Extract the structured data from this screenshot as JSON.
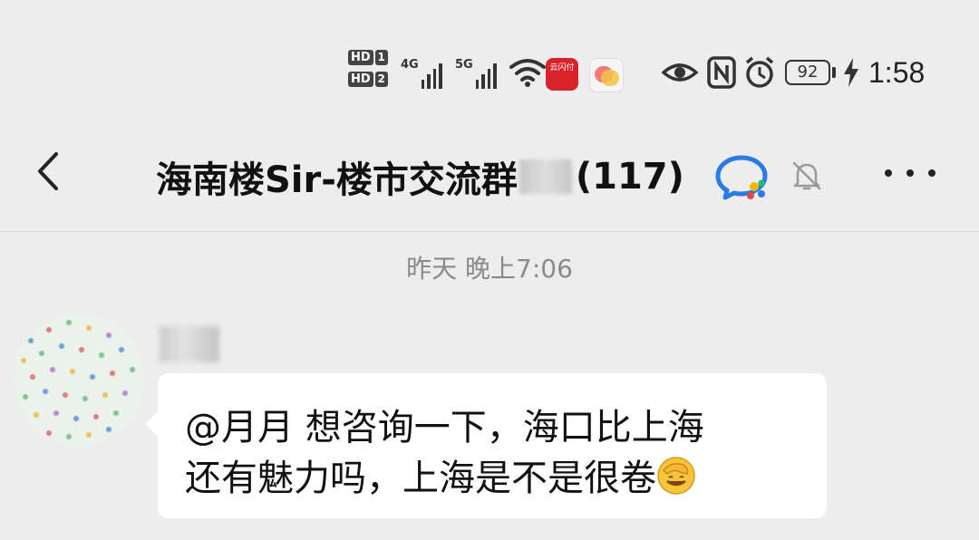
{
  "status_bar": {
    "hd_badges": [
      {
        "label": "HD",
        "sim": "1"
      },
      {
        "label": "HD",
        "sim": "2"
      }
    ],
    "signal_1": "4G",
    "signal_2": "5G",
    "app_icon_text": "云闪付",
    "battery": "92",
    "time": "1:58",
    "icons": [
      "hd-1-icon",
      "hd-2-icon",
      "signal-4g-icon",
      "signal-5g-icon",
      "wifi-icon",
      "unionpay-app-icon",
      "chat-app-icon",
      "eye-icon",
      "nfc-icon",
      "alarm-icon",
      "battery-icon",
      "charging-icon"
    ]
  },
  "header": {
    "title": "海南楼Sir-楼市交流群",
    "member_count": "(117)",
    "icons": [
      "back-icon",
      "wecom-icon",
      "mute-icon",
      "more-icon"
    ]
  },
  "chat": {
    "timestamp": "昨天 晚上7:06",
    "message": {
      "line1": "@月月  想咨询一下，海口比上海",
      "line2": "还有魅力吗，上海是不是很卷",
      "emoji": "facepalm-emoji"
    }
  },
  "colors": {
    "background": "#ededed",
    "bubble": "#ffffff",
    "timestamp": "#8a8a8a",
    "wecom_blue": "#2a7be4"
  }
}
